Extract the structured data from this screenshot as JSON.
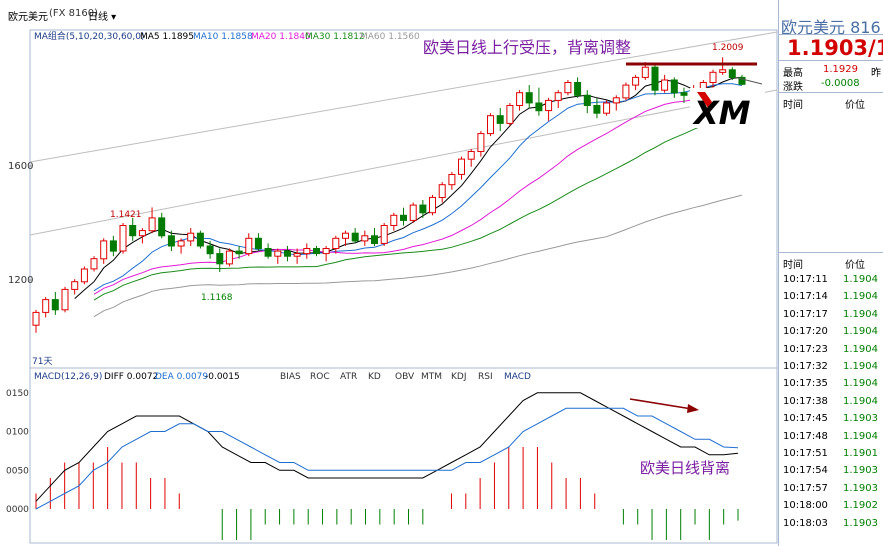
{
  "header": {
    "symbol": "欧元美元",
    "code": "(FX 8160)",
    "period": "日线",
    "period_icon": "chevron-down-icon"
  },
  "ma_legend": {
    "group_label": "MA组合(5,10,20,30,60,0)",
    "items": [
      {
        "label": "MA5 1.1895",
        "color": "#000000"
      },
      {
        "label": "MA10 1.1858",
        "color": "#1f6fd1"
      },
      {
        "label": "MA20 1.1840",
        "color": "#e11bd6"
      },
      {
        "label": "MA30 1.1812",
        "color": "#1a8c1a"
      },
      {
        "label": "MA60 1.1560",
        "color": "#9a9a9a"
      }
    ]
  },
  "macd_legend": {
    "label": "MACD(12,26,9)",
    "diff": "DIFF 0.0072",
    "dea": "DEA 0.0079",
    "macd": "-0.0015"
  },
  "indicator_tabs": [
    "BIAS",
    "ROC",
    "ATR",
    "KD",
    "OBV",
    "MTM",
    "KDJ",
    "RSI",
    "MACD"
  ],
  "annotations": {
    "main_title": "欧美日线上行受压，背离调整",
    "macd_title": "欧美日线背离",
    "high_label": "1.2009",
    "mid_high_label": "1.1421",
    "low_label": "1.1168",
    "ma_days": "71天",
    "logo_text": "XM"
  },
  "price_axis": {
    "labels": [
      "1600",
      "1200"
    ]
  },
  "macd_axis": {
    "labels": [
      "0150",
      "0100",
      "0050",
      "0000"
    ]
  },
  "right_panel": {
    "title": "欧元美元  816",
    "price": "1.1903/1",
    "high_label": "最高",
    "high_value": "1.1929",
    "change_label": "涨跌",
    "change_value": "-0.0008",
    "yesterday_label": "昨",
    "col_time": "时间",
    "col_price": "价位",
    "ticks": [
      {
        "time": "10:17:11",
        "price": "1.1904"
      },
      {
        "time": "10:17:14",
        "price": "1.1904"
      },
      {
        "time": "10:17:17",
        "price": "1.1904"
      },
      {
        "time": "10:17:20",
        "price": "1.1904"
      },
      {
        "time": "10:17:23",
        "price": "1.1904"
      },
      {
        "time": "10:17:32",
        "price": "1.1904"
      },
      {
        "time": "10:17:35",
        "price": "1.1904"
      },
      {
        "time": "10:17:38",
        "price": "1.1904"
      },
      {
        "time": "10:17:45",
        "price": "1.1903"
      },
      {
        "time": "10:17:48",
        "price": "1.1904"
      },
      {
        "time": "10:17:51",
        "price": "1.1901"
      },
      {
        "time": "10:17:54",
        "price": "1.1903"
      },
      {
        "time": "10:17:57",
        "price": "1.1903"
      },
      {
        "time": "10:18:00",
        "price": "1.1902"
      },
      {
        "time": "10:18:03",
        "price": "1.1903"
      }
    ]
  },
  "chart_data": [
    {
      "type": "candlestick",
      "title": "欧美日线上行受压，背离调整",
      "ylim": [
        1.08,
        1.21
      ],
      "candles": [
        {
          "o": 1.096,
          "h": 1.102,
          "l": 1.093,
          "c": 1.101
        },
        {
          "o": 1.101,
          "h": 1.107,
          "l": 1.099,
          "c": 1.106
        },
        {
          "o": 1.106,
          "h": 1.109,
          "l": 1.1,
          "c": 1.102
        },
        {
          "o": 1.102,
          "h": 1.111,
          "l": 1.101,
          "c": 1.11
        },
        {
          "o": 1.11,
          "h": 1.114,
          "l": 1.108,
          "c": 1.113
        },
        {
          "o": 1.113,
          "h": 1.119,
          "l": 1.112,
          "c": 1.118
        },
        {
          "o": 1.118,
          "h": 1.123,
          "l": 1.117,
          "c": 1.122
        },
        {
          "o": 1.122,
          "h": 1.13,
          "l": 1.12,
          "c": 1.129
        },
        {
          "o": 1.129,
          "h": 1.131,
          "l": 1.123,
          "c": 1.125
        },
        {
          "o": 1.125,
          "h": 1.136,
          "l": 1.124,
          "c": 1.135
        },
        {
          "o": 1.135,
          "h": 1.138,
          "l": 1.129,
          "c": 1.131
        },
        {
          "o": 1.131,
          "h": 1.134,
          "l": 1.128,
          "c": 1.133
        },
        {
          "o": 1.133,
          "h": 1.1421,
          "l": 1.132,
          "c": 1.138
        },
        {
          "o": 1.138,
          "h": 1.14,
          "l": 1.13,
          "c": 1.131
        },
        {
          "o": 1.131,
          "h": 1.133,
          "l": 1.125,
          "c": 1.127
        },
        {
          "o": 1.127,
          "h": 1.13,
          "l": 1.124,
          "c": 1.129
        },
        {
          "o": 1.129,
          "h": 1.134,
          "l": 1.127,
          "c": 1.132
        },
        {
          "o": 1.132,
          "h": 1.133,
          "l": 1.126,
          "c": 1.127
        },
        {
          "o": 1.127,
          "h": 1.129,
          "l": 1.122,
          "c": 1.124
        },
        {
          "o": 1.124,
          "h": 1.126,
          "l": 1.1168,
          "c": 1.12
        },
        {
          "o": 1.12,
          "h": 1.126,
          "l": 1.119,
          "c": 1.125
        },
        {
          "o": 1.125,
          "h": 1.127,
          "l": 1.122,
          "c": 1.124
        },
        {
          "o": 1.124,
          "h": 1.132,
          "l": 1.123,
          "c": 1.13
        },
        {
          "o": 1.13,
          "h": 1.132,
          "l": 1.125,
          "c": 1.126
        },
        {
          "o": 1.126,
          "h": 1.128,
          "l": 1.122,
          "c": 1.123
        },
        {
          "o": 1.123,
          "h": 1.126,
          "l": 1.12,
          "c": 1.125
        },
        {
          "o": 1.125,
          "h": 1.127,
          "l": 1.121,
          "c": 1.123
        },
        {
          "o": 1.123,
          "h": 1.126,
          "l": 1.12,
          "c": 1.124
        },
        {
          "o": 1.124,
          "h": 1.128,
          "l": 1.122,
          "c": 1.126
        },
        {
          "o": 1.126,
          "h": 1.127,
          "l": 1.123,
          "c": 1.124
        },
        {
          "o": 1.124,
          "h": 1.127,
          "l": 1.121,
          "c": 1.126
        },
        {
          "o": 1.126,
          "h": 1.131,
          "l": 1.124,
          "c": 1.13
        },
        {
          "o": 1.13,
          "h": 1.133,
          "l": 1.127,
          "c": 1.132
        },
        {
          "o": 1.132,
          "h": 1.134,
          "l": 1.128,
          "c": 1.129
        },
        {
          "o": 1.129,
          "h": 1.133,
          "l": 1.127,
          "c": 1.131
        },
        {
          "o": 1.131,
          "h": 1.134,
          "l": 1.127,
          "c": 1.128
        },
        {
          "o": 1.128,
          "h": 1.136,
          "l": 1.127,
          "c": 1.135
        },
        {
          "o": 1.135,
          "h": 1.14,
          "l": 1.133,
          "c": 1.139
        },
        {
          "o": 1.139,
          "h": 1.142,
          "l": 1.135,
          "c": 1.137
        },
        {
          "o": 1.137,
          "h": 1.144,
          "l": 1.136,
          "c": 1.143
        },
        {
          "o": 1.143,
          "h": 1.145,
          "l": 1.138,
          "c": 1.14
        },
        {
          "o": 1.14,
          "h": 1.147,
          "l": 1.139,
          "c": 1.146
        },
        {
          "o": 1.146,
          "h": 1.152,
          "l": 1.144,
          "c": 1.151
        },
        {
          "o": 1.151,
          "h": 1.156,
          "l": 1.149,
          "c": 1.155
        },
        {
          "o": 1.155,
          "h": 1.162,
          "l": 1.153,
          "c": 1.161
        },
        {
          "o": 1.161,
          "h": 1.165,
          "l": 1.158,
          "c": 1.164
        },
        {
          "o": 1.164,
          "h": 1.172,
          "l": 1.162,
          "c": 1.171
        },
        {
          "o": 1.171,
          "h": 1.179,
          "l": 1.17,
          "c": 1.178
        },
        {
          "o": 1.178,
          "h": 1.181,
          "l": 1.172,
          "c": 1.175
        },
        {
          "o": 1.175,
          "h": 1.183,
          "l": 1.174,
          "c": 1.182
        },
        {
          "o": 1.182,
          "h": 1.188,
          "l": 1.18,
          "c": 1.187
        },
        {
          "o": 1.187,
          "h": 1.19,
          "l": 1.181,
          "c": 1.183
        },
        {
          "o": 1.183,
          "h": 1.189,
          "l": 1.178,
          "c": 1.18
        },
        {
          "o": 1.18,
          "h": 1.185,
          "l": 1.176,
          "c": 1.184
        },
        {
          "o": 1.184,
          "h": 1.188,
          "l": 1.181,
          "c": 1.187
        },
        {
          "o": 1.187,
          "h": 1.192,
          "l": 1.186,
          "c": 1.191
        },
        {
          "o": 1.191,
          "h": 1.193,
          "l": 1.185,
          "c": 1.186
        },
        {
          "o": 1.186,
          "h": 1.188,
          "l": 1.179,
          "c": 1.182
        },
        {
          "o": 1.182,
          "h": 1.185,
          "l": 1.177,
          "c": 1.179
        },
        {
          "o": 1.179,
          "h": 1.184,
          "l": 1.178,
          "c": 1.183
        },
        {
          "o": 1.183,
          "h": 1.186,
          "l": 1.18,
          "c": 1.185
        },
        {
          "o": 1.185,
          "h": 1.191,
          "l": 1.184,
          "c": 1.19
        },
        {
          "o": 1.19,
          "h": 1.194,
          "l": 1.188,
          "c": 1.193
        },
        {
          "o": 1.193,
          "h": 1.199,
          "l": 1.192,
          "c": 1.197
        },
        {
          "o": 1.197,
          "h": 1.198,
          "l": 1.186,
          "c": 1.188
        },
        {
          "o": 1.188,
          "h": 1.194,
          "l": 1.187,
          "c": 1.192
        },
        {
          "o": 1.192,
          "h": 1.193,
          "l": 1.185,
          "c": 1.187
        },
        {
          "o": 1.187,
          "h": 1.189,
          "l": 1.183,
          "c": 1.186
        },
        {
          "o": 1.186,
          "h": 1.19,
          "l": 1.184,
          "c": 1.188
        },
        {
          "o": 1.188,
          "h": 1.192,
          "l": 1.186,
          "c": 1.191
        },
        {
          "o": 1.191,
          "h": 1.196,
          "l": 1.189,
          "c": 1.195
        },
        {
          "o": 1.195,
          "h": 1.2009,
          "l": 1.194,
          "c": 1.196
        },
        {
          "o": 1.196,
          "h": 1.197,
          "l": 1.192,
          "c": 1.193
        },
        {
          "o": 1.193,
          "h": 1.194,
          "l": 1.19,
          "c": 1.1903
        }
      ]
    },
    {
      "type": "bar+line",
      "title": "MACD(12,26,9)",
      "ylim": [
        -0.004,
        0.016
      ],
      "series": [
        {
          "name": "DIFF",
          "values": [
            0.001,
            0.003,
            0.005,
            0.006,
            0.008,
            0.01,
            0.011,
            0.012,
            0.012,
            0.012,
            0.012,
            0.011,
            0.01,
            0.008,
            0.007,
            0.006,
            0.006,
            0.005,
            0.005,
            0.004,
            0.004,
            0.004,
            0.004,
            0.004,
            0.004,
            0.004,
            0.004,
            0.004,
            0.005,
            0.006,
            0.007,
            0.008,
            0.01,
            0.012,
            0.014,
            0.015,
            0.015,
            0.015,
            0.015,
            0.014,
            0.013,
            0.012,
            0.011,
            0.01,
            0.009,
            0.008,
            0.008,
            0.007,
            0.007,
            0.0072
          ]
        },
        {
          "name": "DEA",
          "values": [
            0.0,
            0.001,
            0.002,
            0.003,
            0.005,
            0.006,
            0.008,
            0.009,
            0.01,
            0.01,
            0.011,
            0.011,
            0.01,
            0.01,
            0.009,
            0.008,
            0.007,
            0.006,
            0.006,
            0.005,
            0.005,
            0.005,
            0.005,
            0.005,
            0.005,
            0.005,
            0.005,
            0.005,
            0.005,
            0.005,
            0.006,
            0.006,
            0.007,
            0.008,
            0.01,
            0.011,
            0.012,
            0.013,
            0.013,
            0.013,
            0.013,
            0.013,
            0.012,
            0.012,
            0.011,
            0.01,
            0.009,
            0.009,
            0.008,
            0.0079
          ]
        },
        {
          "name": "MACD",
          "values": [
            0.002,
            0.004,
            0.006,
            0.006,
            0.006,
            0.008,
            0.006,
            0.006,
            0.004,
            0.004,
            0.002,
            0.0,
            0.0,
            -0.004,
            -0.004,
            -0.004,
            -0.002,
            -0.002,
            -0.002,
            -0.002,
            -0.002,
            -0.002,
            -0.002,
            -0.002,
            -0.002,
            -0.002,
            -0.002,
            -0.002,
            0.0,
            0.002,
            0.002,
            0.004,
            0.006,
            0.008,
            0.008,
            0.008,
            0.006,
            0.004,
            0.004,
            0.002,
            0.0,
            -0.002,
            -0.002,
            -0.004,
            -0.004,
            -0.004,
            -0.002,
            -0.004,
            -0.002,
            -0.0015
          ]
        }
      ]
    }
  ]
}
